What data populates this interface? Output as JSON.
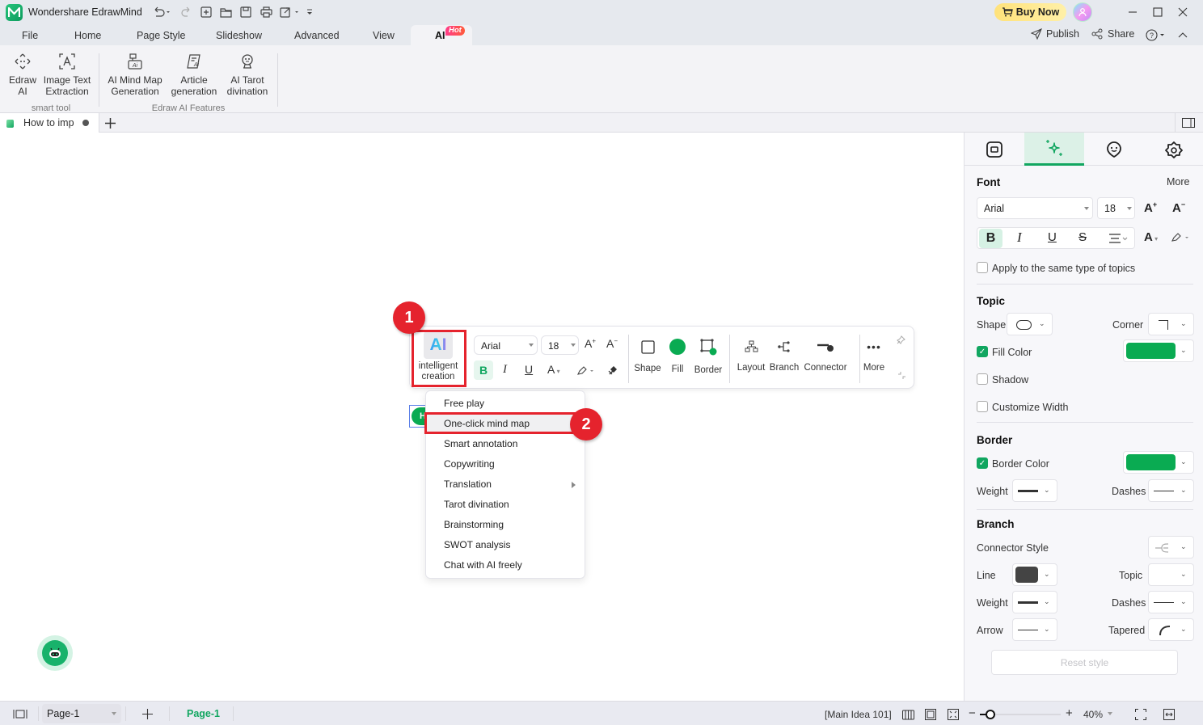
{
  "app": {
    "title": "Wondershare EdrawMind"
  },
  "titlebar": {
    "buy_now": "Buy Now",
    "quick_icons": [
      "undo-icon",
      "redo-icon",
      "new-icon",
      "open-icon",
      "save-icon",
      "print-icon",
      "export-icon",
      "customize-icon"
    ]
  },
  "menu": {
    "items": [
      "File",
      "Home",
      "Page Style",
      "Slideshow",
      "Advanced",
      "View",
      "AI"
    ],
    "active": "AI",
    "hot_badge": "Hot",
    "publish": "Publish",
    "share": "Share"
  },
  "ribbon": {
    "groups": [
      {
        "label": "smart tool",
        "buttons": [
          {
            "label1": "Edraw",
            "label2": "AI",
            "icon": "edraw-ai-icon"
          },
          {
            "label1": "Image Text",
            "label2": "Extraction",
            "icon": "image-text-extraction-icon"
          }
        ]
      },
      {
        "label": "Edraw AI Features",
        "buttons": [
          {
            "label1": "AI Mind Map",
            "label2": "Generation",
            "icon": "ai-mind-map-icon"
          },
          {
            "label1": "Article",
            "label2": "generation",
            "icon": "article-generation-icon"
          },
          {
            "label1": "AI Tarot",
            "label2": "divination",
            "icon": "tarot-icon"
          }
        ]
      }
    ]
  },
  "doc_tab": {
    "title": "How to imp"
  },
  "floating_toolbar": {
    "ai_label1": "intelligent",
    "ai_label2": "creation",
    "ai_glyph": "AI",
    "font": "Arial",
    "size": "18",
    "bold": "B",
    "shape": "Shape",
    "fill": "Fill",
    "border": "Border",
    "layout": "Layout",
    "branch": "Branch",
    "connector": "Connector",
    "more": "More",
    "fill_color": "#0aab52"
  },
  "context_menu": {
    "items": [
      "Free play",
      "One-click mind map",
      "Smart annotation",
      "Copywriting",
      "Translation",
      "Tarot divination",
      "Brainstorming",
      "SWOT analysis",
      "Chat with AI freely"
    ],
    "highlighted": "One-click mind map"
  },
  "annotations": {
    "step1": "1",
    "step2": "2",
    "color": "#e5232d"
  },
  "topic_node": {
    "letter": "H"
  },
  "right_panel": {
    "font": {
      "title": "Font",
      "more": "More",
      "family": "Arial",
      "size": "18",
      "apply_same": "Apply to the same type of topics"
    },
    "topic": {
      "title": "Topic",
      "shape": "Shape",
      "corner": "Corner",
      "fill_color": "Fill Color",
      "fill_checked": true,
      "shadow": "Shadow",
      "customize_width": "Customize Width",
      "color": "#0aab52"
    },
    "border": {
      "title": "Border",
      "border_color": "Border Color",
      "weight": "Weight",
      "dashes": "Dashes",
      "color": "#0aab52"
    },
    "branch": {
      "title": "Branch",
      "connector_style": "Connector Style",
      "line": "Line",
      "topic": "Topic",
      "weight": "Weight",
      "dashes": "Dashes",
      "arrow": "Arrow",
      "tapered": "Tapered",
      "reset": "Reset style",
      "line_color": "#444444"
    }
  },
  "statusbar": {
    "page_select": "Page-1",
    "page_tab": "Page-1",
    "selection": "[Main Idea 101]",
    "zoom": "40%",
    "zoom_level_percent": 40
  }
}
